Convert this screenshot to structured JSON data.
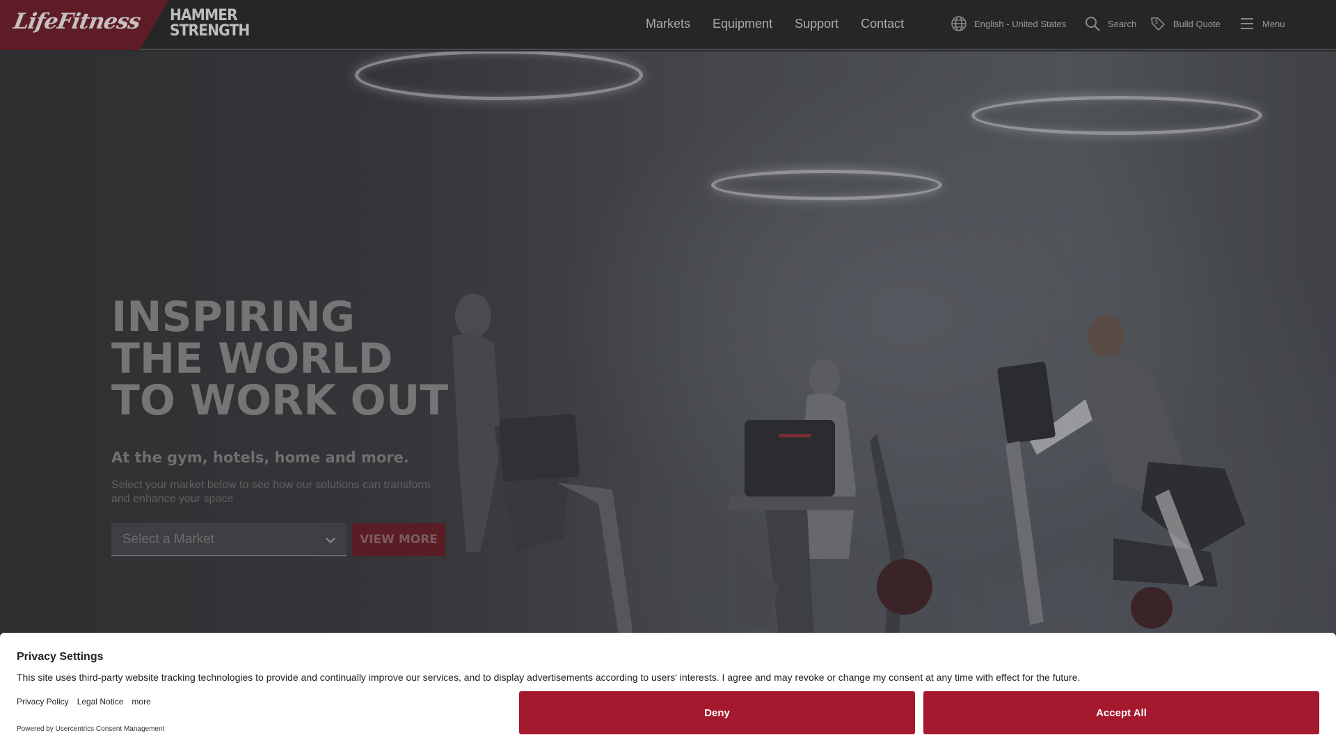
{
  "header": {
    "brand_primary": "LifeFitness",
    "brand_secondary_line1": "HAMMER",
    "brand_secondary_line2": "STRENGTH",
    "nav": [
      "Markets",
      "Equipment",
      "Support",
      "Contact"
    ],
    "language": "English - United States",
    "search_label": "Search",
    "quote_label": "Build Quote",
    "menu_label": "Menu",
    "icons": {
      "language": "globe-icon",
      "search": "search-icon",
      "quote": "price-tag-icon",
      "menu": "hamburger-icon"
    }
  },
  "hero": {
    "title_lines": [
      "INSPIRING",
      "THE WORLD",
      "TO WORK OUT"
    ],
    "subtitle": "At the gym, hotels, home and more.",
    "description": "Select your market below to see how our solutions can transform and enhance your space",
    "market_select": {
      "placeholder": "Select a Market"
    },
    "cta_label": "VIEW MORE"
  },
  "consent": {
    "title": "Privacy Settings",
    "text": "This site uses third-party website tracking technologies to provide and continually improve our services, and to display advertisements according to users' interests. I agree and may revoke or change my consent at any time with effect for the future.",
    "links": [
      "Privacy Policy",
      "Legal Notice",
      "more"
    ],
    "powered_by": "Powered by Usercentrics Consent Management",
    "deny_label": "Deny",
    "accept_label": "Accept All"
  },
  "colors": {
    "brand_red": "#a5192f",
    "header_bg": "#262626",
    "consent_bg": "#ffffff"
  }
}
